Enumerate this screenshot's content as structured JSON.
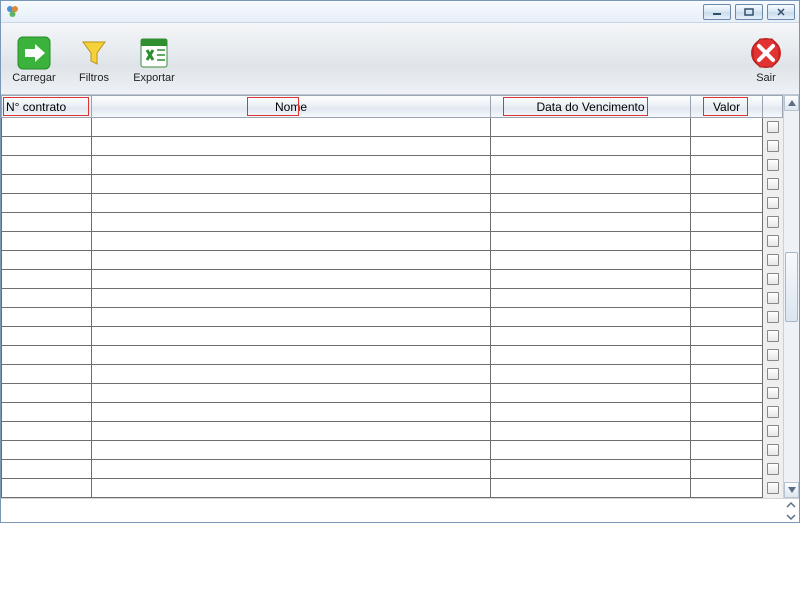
{
  "window": {
    "title": ""
  },
  "toolbar": {
    "carregar_label": "Carregar",
    "filtros_label": "Filtros",
    "exportar_label": "Exportar",
    "sair_label": "Sair"
  },
  "table": {
    "columns": {
      "contrato": "N° contrato",
      "nome": "Nome",
      "data": "Data do Vencimento",
      "valor": "Valor"
    },
    "rows": [
      {},
      {},
      {},
      {},
      {},
      {},
      {},
      {},
      {},
      {},
      {},
      {},
      {},
      {},
      {},
      {},
      {},
      {},
      {},
      {}
    ]
  }
}
